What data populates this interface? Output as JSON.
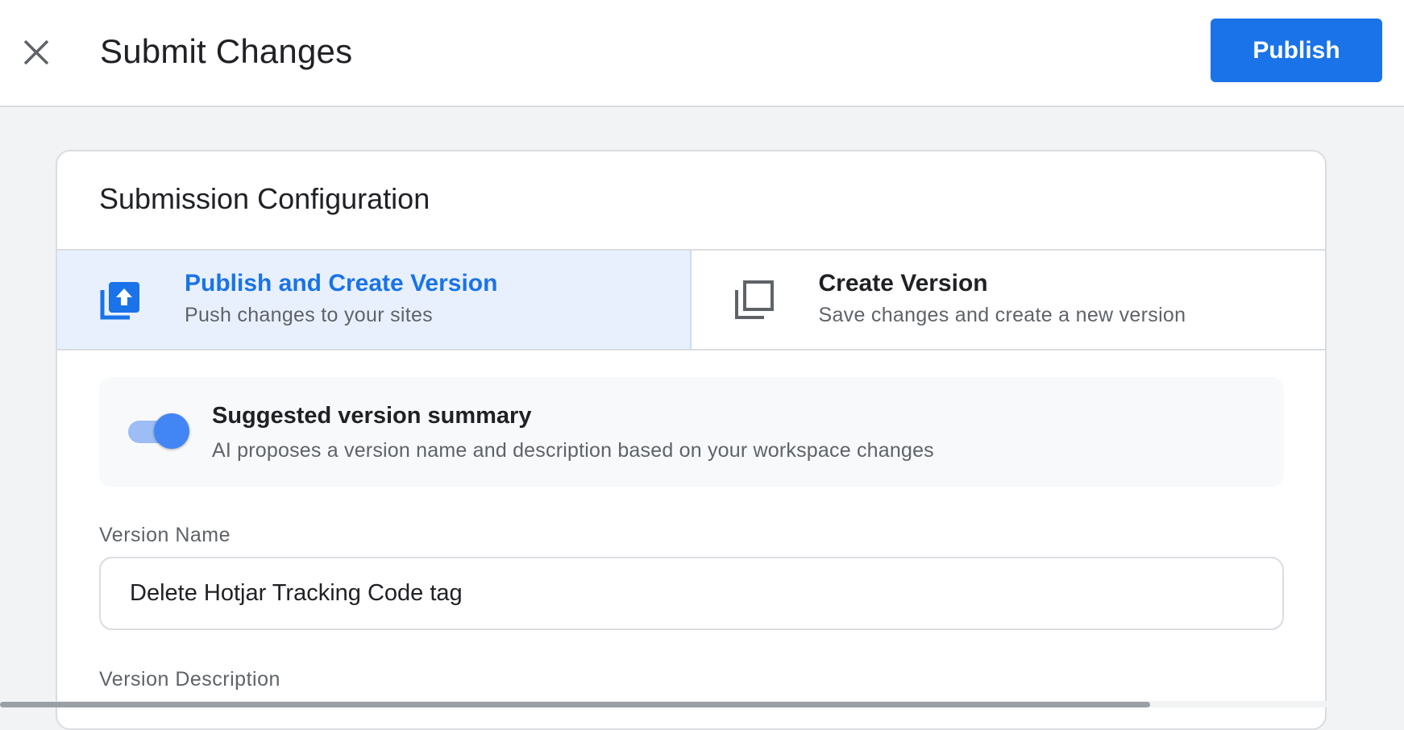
{
  "header": {
    "title": "Submit Changes",
    "publish_label": "Publish",
    "close_icon": "close-icon"
  },
  "card": {
    "title": "Submission Configuration",
    "options": [
      {
        "title": "Publish and Create Version",
        "subtitle": "Push changes to your sites",
        "icon": "publish-upload-icon",
        "selected": true
      },
      {
        "title": "Create Version",
        "subtitle": "Save changes and create a new version",
        "icon": "copy-stack-icon",
        "selected": false
      }
    ],
    "summary": {
      "title": "Suggested version summary",
      "subtitle": "AI proposes a version name and description based on your workspace changes",
      "toggle_on": true
    },
    "version_name": {
      "label": "Version Name",
      "value": "Delete Hotjar Tracking Code tag"
    },
    "version_description": {
      "label": "Version Description"
    }
  },
  "colors": {
    "accent": "#1a73e8",
    "selected_bg": "#e8f0fe",
    "page_bg": "#f1f3f4"
  }
}
